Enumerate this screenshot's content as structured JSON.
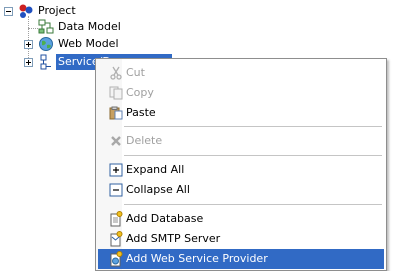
{
  "tree": {
    "root_label": "Project",
    "items": [
      {
        "label": "Data Model"
      },
      {
        "label": "Web Model"
      },
      {
        "label": "Service/D"
      }
    ]
  },
  "menu": {
    "items": [
      {
        "label": "Cut",
        "enabled": false,
        "icon": "scissors-icon"
      },
      {
        "label": "Copy",
        "enabled": false,
        "icon": "copy-icon"
      },
      {
        "label": "Paste",
        "enabled": true,
        "icon": "paste-icon"
      },
      {
        "label": "Delete",
        "enabled": false,
        "icon": "delete-icon"
      },
      {
        "label": "Expand All",
        "enabled": true,
        "icon": "expand-all-icon"
      },
      {
        "label": "Collapse All",
        "enabled": true,
        "icon": "collapse-all-icon"
      },
      {
        "label": "Add Database",
        "enabled": true,
        "icon": "add-database-icon"
      },
      {
        "label": "Add SMTP Server",
        "enabled": true,
        "icon": "add-smtp-server-icon"
      },
      {
        "label": "Add Web Service Provider",
        "enabled": true,
        "icon": "add-web-service-provider-icon",
        "highlighted": true
      }
    ]
  },
  "colors": {
    "selection": "#316ac5",
    "disabled_text": "#a0a0a0"
  }
}
